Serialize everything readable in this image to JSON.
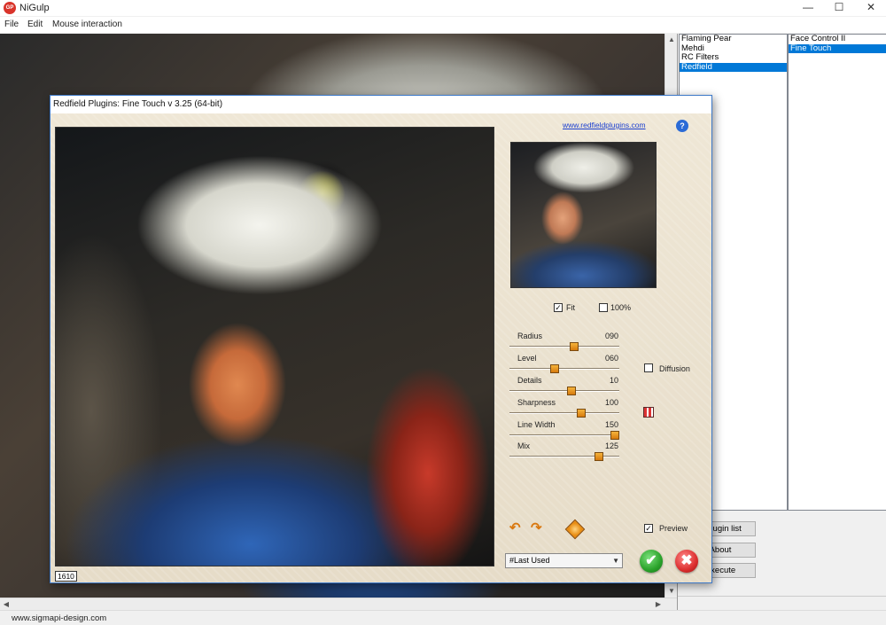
{
  "app": {
    "logo_text": "GP",
    "title": "NiGulp",
    "window_controls": {
      "minimize": "—",
      "maximize": "☐",
      "close": "✕"
    }
  },
  "menu": [
    {
      "label": "File"
    },
    {
      "label": "Edit"
    },
    {
      "label": "Mouse interaction"
    }
  ],
  "plugin_panel": {
    "vendors": [
      {
        "label": "Flaming Pear",
        "selected": false
      },
      {
        "label": "Mehdi",
        "selected": false
      },
      {
        "label": "RC Filters",
        "selected": false
      },
      {
        "label": "Redfield",
        "selected": true
      }
    ],
    "plugins": [
      {
        "label": "Face Control II",
        "selected": false
      },
      {
        "label": "Fine Touch",
        "selected": true
      }
    ],
    "buttons": {
      "load_plugin_list": "d plugin list",
      "about": "About",
      "execute": "Execute"
    }
  },
  "status": {
    "text": "www.sigmapi-design.com"
  },
  "dialog": {
    "title": "Redfield Plugins: Fine Touch v 3.25 (64-bit)",
    "link": "www.redfieldplugins.com",
    "help": "?",
    "size_label": "1610",
    "fit": {
      "label": "Fit",
      "checked": true
    },
    "full": {
      "label": "100%",
      "checked": false
    },
    "sliders": [
      {
        "label": "Radius",
        "value": "090",
        "fraction": 0.6
      },
      {
        "label": "Level",
        "value": "060",
        "fraction": 0.4
      },
      {
        "label": "Details",
        "value": "10",
        "fraction": 0.57
      },
      {
        "label": "Sharpness",
        "value": "100",
        "fraction": 0.67
      },
      {
        "label": "Line Width",
        "value": "150",
        "fraction": 1.0
      },
      {
        "label": "Mix",
        "value": "125",
        "fraction": 0.84
      }
    ],
    "diffusion": {
      "label": "Diffusion",
      "checked": false
    },
    "preview": {
      "label": "Preview",
      "checked": true
    },
    "preset": "#Last Used",
    "icons": {
      "undo": "↶",
      "redo": "↷",
      "ok": "✔",
      "cancel": "✖"
    }
  }
}
